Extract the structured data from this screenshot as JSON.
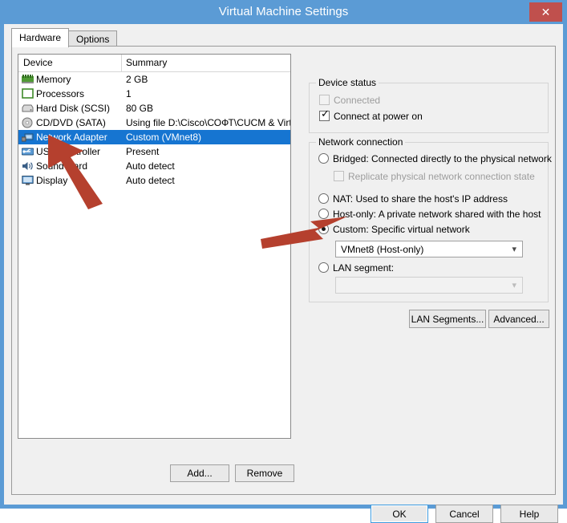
{
  "window": {
    "title": "Virtual Machine Settings",
    "close_label": "✕"
  },
  "tabs": [
    {
      "label": "Hardware",
      "active": true
    },
    {
      "label": "Options",
      "active": false
    }
  ],
  "device_list": {
    "columns": [
      "Device",
      "Summary"
    ],
    "rows": [
      {
        "icon": "memory-icon",
        "device": "Memory",
        "summary": "2 GB",
        "selected": false
      },
      {
        "icon": "processor-icon",
        "device": "Processors",
        "summary": "1",
        "selected": false
      },
      {
        "icon": "hard-disk-icon",
        "device": "Hard Disk (SCSI)",
        "summary": "80 GB",
        "selected": false
      },
      {
        "icon": "cd-dvd-icon",
        "device": "CD/DVD (SATA)",
        "summary": "Using file D:\\Cisco\\СОФТ\\CUCM & Virtu…",
        "selected": false
      },
      {
        "icon": "network-adapter-icon",
        "device": "Network Adapter",
        "summary": "Custom (VMnet8)",
        "selected": true
      },
      {
        "icon": "usb-controller-icon",
        "device": "USB Controller",
        "summary": "Present",
        "selected": false
      },
      {
        "icon": "sound-card-icon",
        "device": "Sound Card",
        "summary": "Auto detect",
        "selected": false
      },
      {
        "icon": "display-icon",
        "device": "Display",
        "summary": "Auto detect",
        "selected": false
      }
    ]
  },
  "list_buttons": {
    "add_label": "Add...",
    "remove_label": "Remove"
  },
  "device_status": {
    "group_label": "Device status",
    "connected": {
      "label": "Connected",
      "checked": false,
      "disabled": true
    },
    "connect_at_power_on": {
      "label": "Connect at power on",
      "checked": true,
      "disabled": false
    }
  },
  "network_connection": {
    "group_label": "Network connection",
    "options": [
      {
        "label": "Bridged: Connected directly to the physical network",
        "selected": false
      },
      {
        "label": "NAT: Used to share the host's IP address",
        "selected": false
      },
      {
        "label": "Host-only: A private network shared with the host",
        "selected": false
      },
      {
        "label": "Custom: Specific virtual network",
        "selected": true
      },
      {
        "label": "LAN segment:",
        "selected": false
      }
    ],
    "replicate_checkbox": {
      "label": "Replicate physical network connection state",
      "checked": false,
      "disabled": true
    },
    "custom_network": {
      "value": "VMnet8 (Host-only)",
      "disabled": false
    },
    "lan_segment_combo": {
      "value": "",
      "disabled": true
    },
    "lan_segments_button": "LAN Segments...",
    "advanced_button": "Advanced..."
  },
  "dialog_buttons": {
    "ok": "OK",
    "cancel": "Cancel",
    "help": "Help"
  },
  "annotations": {
    "arrow_color": "#b5402e",
    "arrows": [
      {
        "name": "arrow-to-network-adapter",
        "points_to": "Network Adapter"
      },
      {
        "name": "arrow-to-custom-network-combo",
        "points_to": "VMnet8 (Host-only)"
      }
    ]
  },
  "colors": {
    "window_frame": "#5b9bd5",
    "dialog_background": "#f0f0f0",
    "selection_blue": "#1675d1",
    "close_button_red": "#c0504d"
  }
}
